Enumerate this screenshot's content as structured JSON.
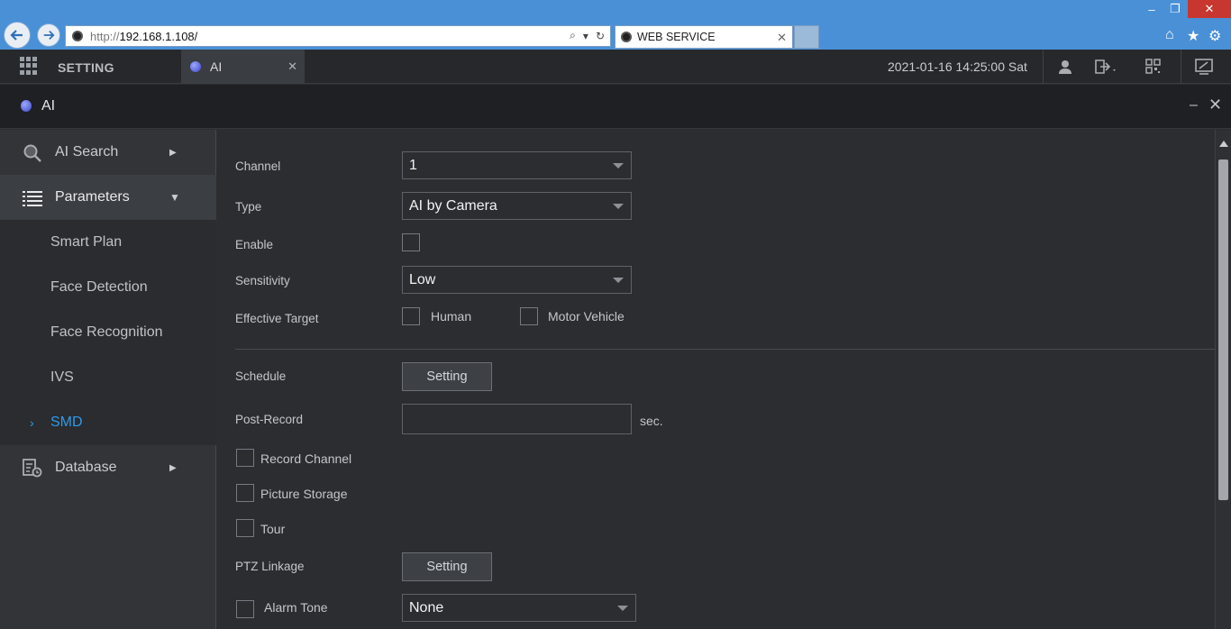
{
  "browser": {
    "url_proto": "http://",
    "url_host": "192.168.1.108/",
    "tab_title": "WEB SERVICE",
    "icons": [
      "back-icon",
      "forward-icon",
      "search-icon",
      "refresh-icon",
      "home-icon",
      "favorites-icon",
      "settings-gear-icon"
    ]
  },
  "header": {
    "setting_label": "SETTING",
    "tab_label": "AI",
    "datetime": "2021-01-16 14:25:00 Sat"
  },
  "window": {
    "title": "AI"
  },
  "sidebar": {
    "ai_search": "AI Search",
    "parameters": "Parameters",
    "items": [
      {
        "label": "Smart Plan"
      },
      {
        "label": "Face Detection"
      },
      {
        "label": "Face Recognition"
      },
      {
        "label": "IVS"
      },
      {
        "label": "SMD"
      }
    ],
    "database": "Database"
  },
  "form": {
    "channel_label": "Channel",
    "channel_value": "1",
    "type_label": "Type",
    "type_value": "AI by Camera",
    "enable_label": "Enable",
    "sensitivity_label": "Sensitivity",
    "sensitivity_value": "Low",
    "effective_target_label": "Effective Target",
    "target_human": "Human",
    "target_vehicle": "Motor Vehicle",
    "schedule_label": "Schedule",
    "schedule_button": "Setting",
    "post_record_label": "Post-Record",
    "post_record_value": "",
    "post_record_unit": "sec.",
    "record_channel": "Record Channel",
    "picture_storage": "Picture Storage",
    "tour": "Tour",
    "ptz_label": "PTZ Linkage",
    "ptz_button": "Setting",
    "alarm_tone_label": "Alarm Tone",
    "alarm_tone_value": "None"
  },
  "colors": {
    "accent": "#2f9bea",
    "browser_bar": "#4a90d6",
    "background": "#2b2d31"
  }
}
